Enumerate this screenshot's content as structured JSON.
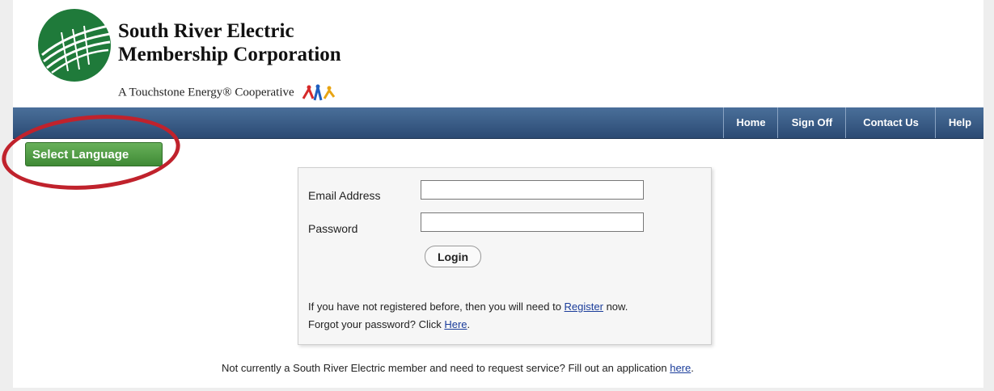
{
  "header": {
    "org_name_line1": "South River Electric",
    "org_name_line2": "Membership Corporation",
    "tagline": "A Touchstone Energy® Cooperative",
    "logo_icon": "south-river-globe-logo",
    "tagline_icon": "touchstone-figures-logo"
  },
  "nav": {
    "items": [
      {
        "label": "Home"
      },
      {
        "label": "Sign Off"
      },
      {
        "label": "Contact Us"
      },
      {
        "label": "Help"
      }
    ]
  },
  "language": {
    "button_label": "Select Language"
  },
  "login": {
    "email_label": "Email Address",
    "email_value": "",
    "password_label": "Password",
    "password_value": "",
    "login_button": "Login",
    "register_prefix": "If you have not registered before, then you will need to ",
    "register_link": "Register",
    "register_suffix": " now.",
    "forgot_prefix": "Forgot your password? Click ",
    "forgot_link": "Here",
    "forgot_suffix": "."
  },
  "footer": {
    "service_prefix": "Not currently a South River Electric member and need to request service? Fill out an application ",
    "service_link": "here",
    "service_suffix": "."
  },
  "colors": {
    "nav_bar": "#2f4f7a",
    "language_button": "#4f9b43",
    "highlight_ring": "#c0222c",
    "logo_green": "#1f7a3a",
    "link": "#1a3c9a"
  }
}
